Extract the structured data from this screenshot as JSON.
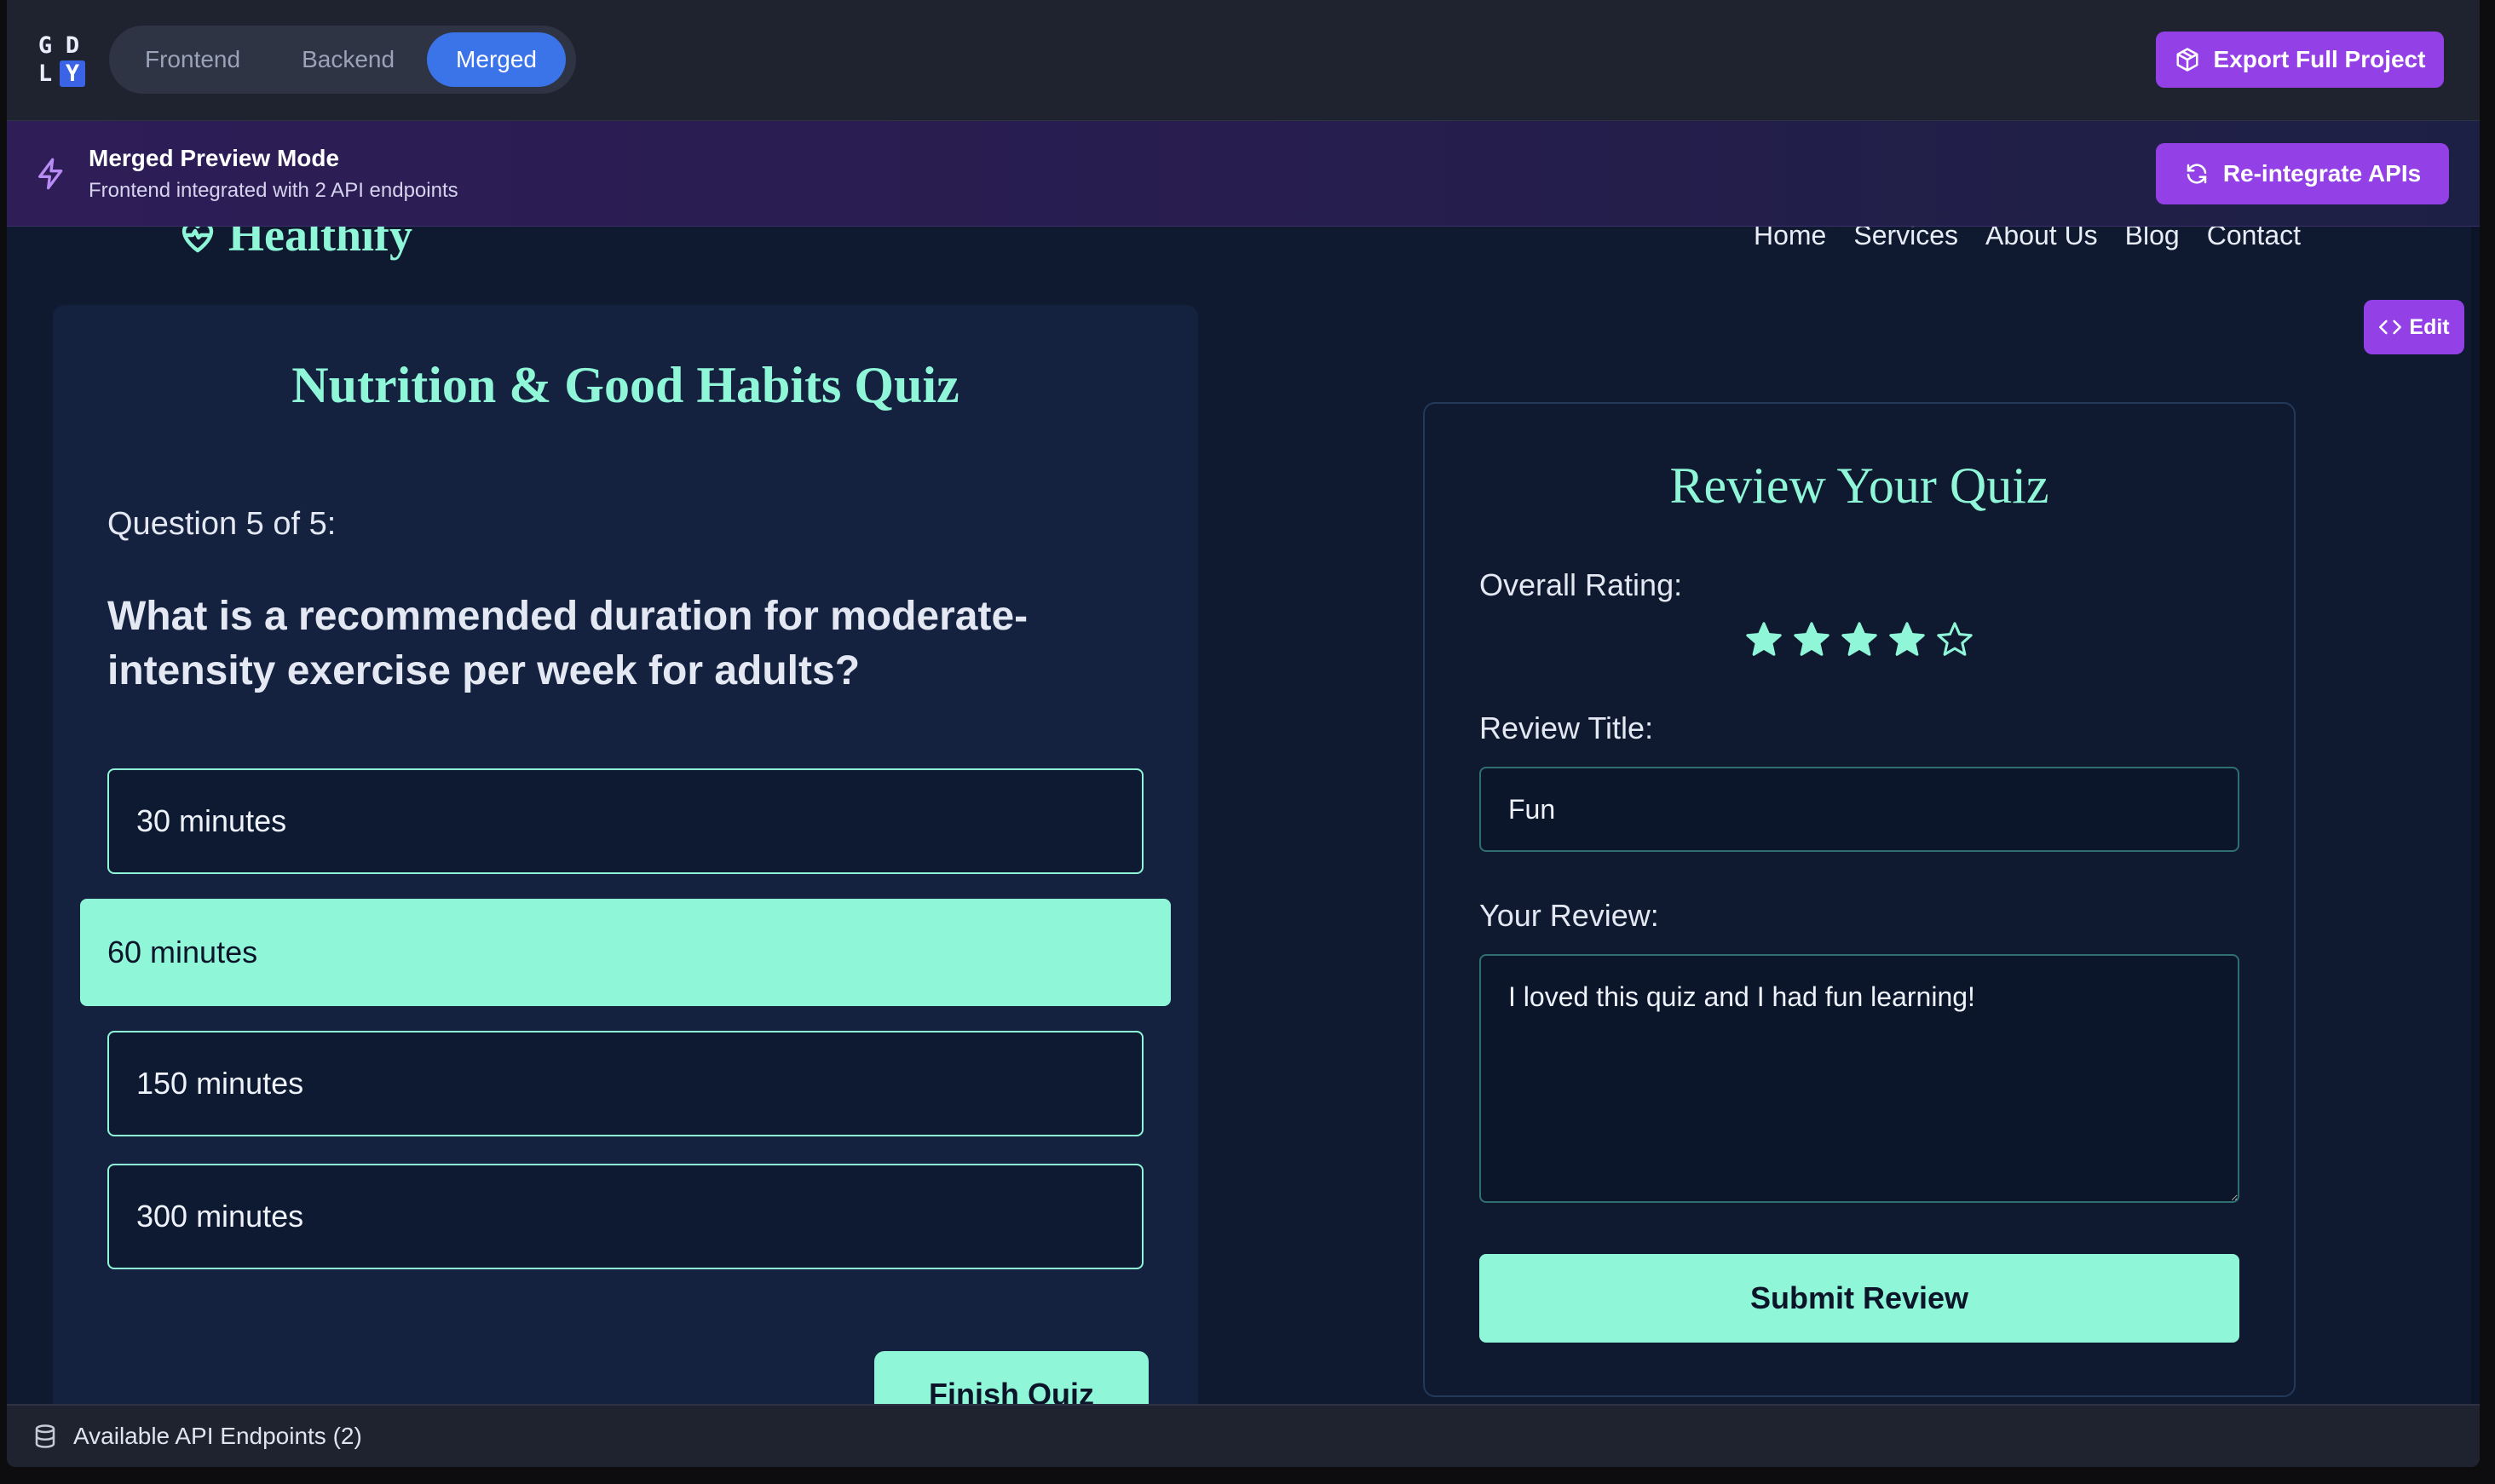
{
  "toolbar": {
    "logo": [
      "G",
      "D",
      "L",
      "Y"
    ],
    "tabs": [
      {
        "label": "Frontend",
        "active": false
      },
      {
        "label": "Backend",
        "active": false
      },
      {
        "label": "Merged",
        "active": true
      }
    ],
    "export_label": "Export Full Project"
  },
  "banner": {
    "title": "Merged Preview Mode",
    "subtitle": "Frontend integrated with 2 API endpoints",
    "reintegrate_label": "Re-integrate APIs"
  },
  "site": {
    "brand": "Healthify",
    "nav": [
      "Home",
      "Services",
      "About Us",
      "Blog",
      "Contact"
    ]
  },
  "edit_label": "Edit",
  "quiz": {
    "title": "Nutrition & Good Habits Quiz",
    "question_number": "Question 5 of 5:",
    "question": "What is a recommended duration for moderate-intensity exercise per week for adults?",
    "options": [
      "30 minutes",
      "60 minutes",
      "150 minutes",
      "300 minutes"
    ],
    "selected_index": 1,
    "finish_label": "Finish Quiz"
  },
  "review": {
    "title": "Review Your Quiz",
    "rating_label": "Overall Rating:",
    "rating": 4,
    "rating_max": 5,
    "title_label": "Review Title:",
    "title_value": "Fun",
    "review_label": "Your Review:",
    "review_value": "I loved this quiz and I had fun learning!",
    "submit_label": "Submit Review"
  },
  "endpoints_label": "Available API Endpoints (2)",
  "colors": {
    "accent": "#8ff7d8",
    "purple": "#9341e6",
    "blue_tab": "#3b73e8",
    "background": "#0f1a30",
    "card": "#142240"
  }
}
